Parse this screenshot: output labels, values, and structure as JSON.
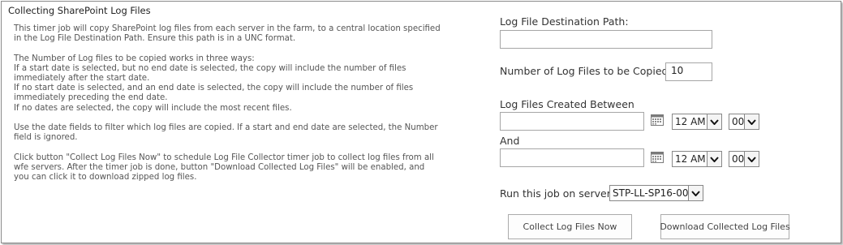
{
  "section": {
    "title": "Collecting SharePoint Log Files",
    "description": [
      "This timer job will copy SharePoint log files from each server in the farm, to a central location specified",
      "in the Log File Destination Path. Ensure this path is in a UNC format.",
      "",
      "The Number of Log files to be copied works in three ways:",
      "If a start date is selected, but no end date is selected, the copy will include the number of files",
      "immediately after the start date.",
      "If no start date is selected, and an end date is selected, the copy will include the number of files",
      "immediately preceding the end date.",
      "If no dates are selected, the copy will include the most recent files.",
      "",
      "Use the date fields to filter which log files are copied. If a start and end date are selected, the Number",
      "field is ignored.",
      "",
      "Click button \"Collect Log Files Now\" to schedule Log File Collector timer job to collect log files from all",
      "wfe servers. After the timer job is done, button \"Download Collected Log Files\" will be enabled, and",
      "you can click it to download zipped log files."
    ]
  },
  "form": {
    "destination_label": "Log File Destination Path:",
    "destination_value": "",
    "count_label": "Number of Log Files to be Copied:",
    "count_value": "10",
    "created_between_label": "Log Files Created Between",
    "start": {
      "date": "",
      "hour": "12 AM",
      "minute": "00"
    },
    "and_label": "And",
    "end": {
      "date": "",
      "hour": "12 AM",
      "minute": "00"
    },
    "server_label": "Run this job on server:",
    "server_value": "STP-LL-SP16-00",
    "collect_button": "Collect Log Files Now",
    "download_button": "Download Collected Log Files"
  },
  "icons": {
    "calendar": "calendar-icon",
    "dropdown": "chevron-down-icon"
  }
}
